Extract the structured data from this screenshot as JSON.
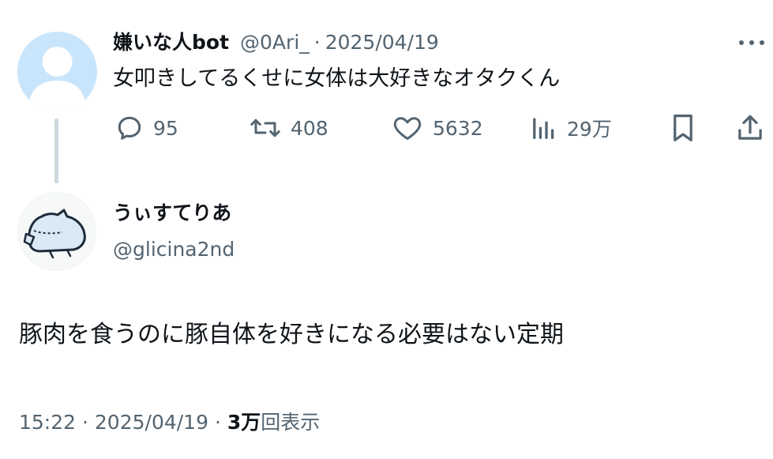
{
  "parent_tweet": {
    "display_name": "嫌いな人bot",
    "handle": "@0Ari_",
    "date": "2025/04/19",
    "text": "女叩きしてるくせに女体は大好きなオタクくん",
    "replies": "95",
    "retweets": "408",
    "likes": "5632",
    "views": "29万"
  },
  "reply_tweet": {
    "display_name": "うぃすてりあ",
    "handle": "@glicina2nd",
    "text": "豚肉を食うのに豚自体を好きになる必要はない定期",
    "time": "15:22",
    "date": "2025/04/19",
    "views_count": "3万",
    "views_label": "回表示"
  },
  "icons": {
    "reply": "reply-icon",
    "retweet": "retweet-icon",
    "like": "heart-icon",
    "views": "views-chart-icon",
    "bookmark": "bookmark-icon",
    "share": "share-icon",
    "more": "more-icon"
  },
  "colors": {
    "text": "#0f1419",
    "secondary": "#536471",
    "avatar_placeholder": "#c9e5fb",
    "thread_line": "#cfd9de"
  }
}
